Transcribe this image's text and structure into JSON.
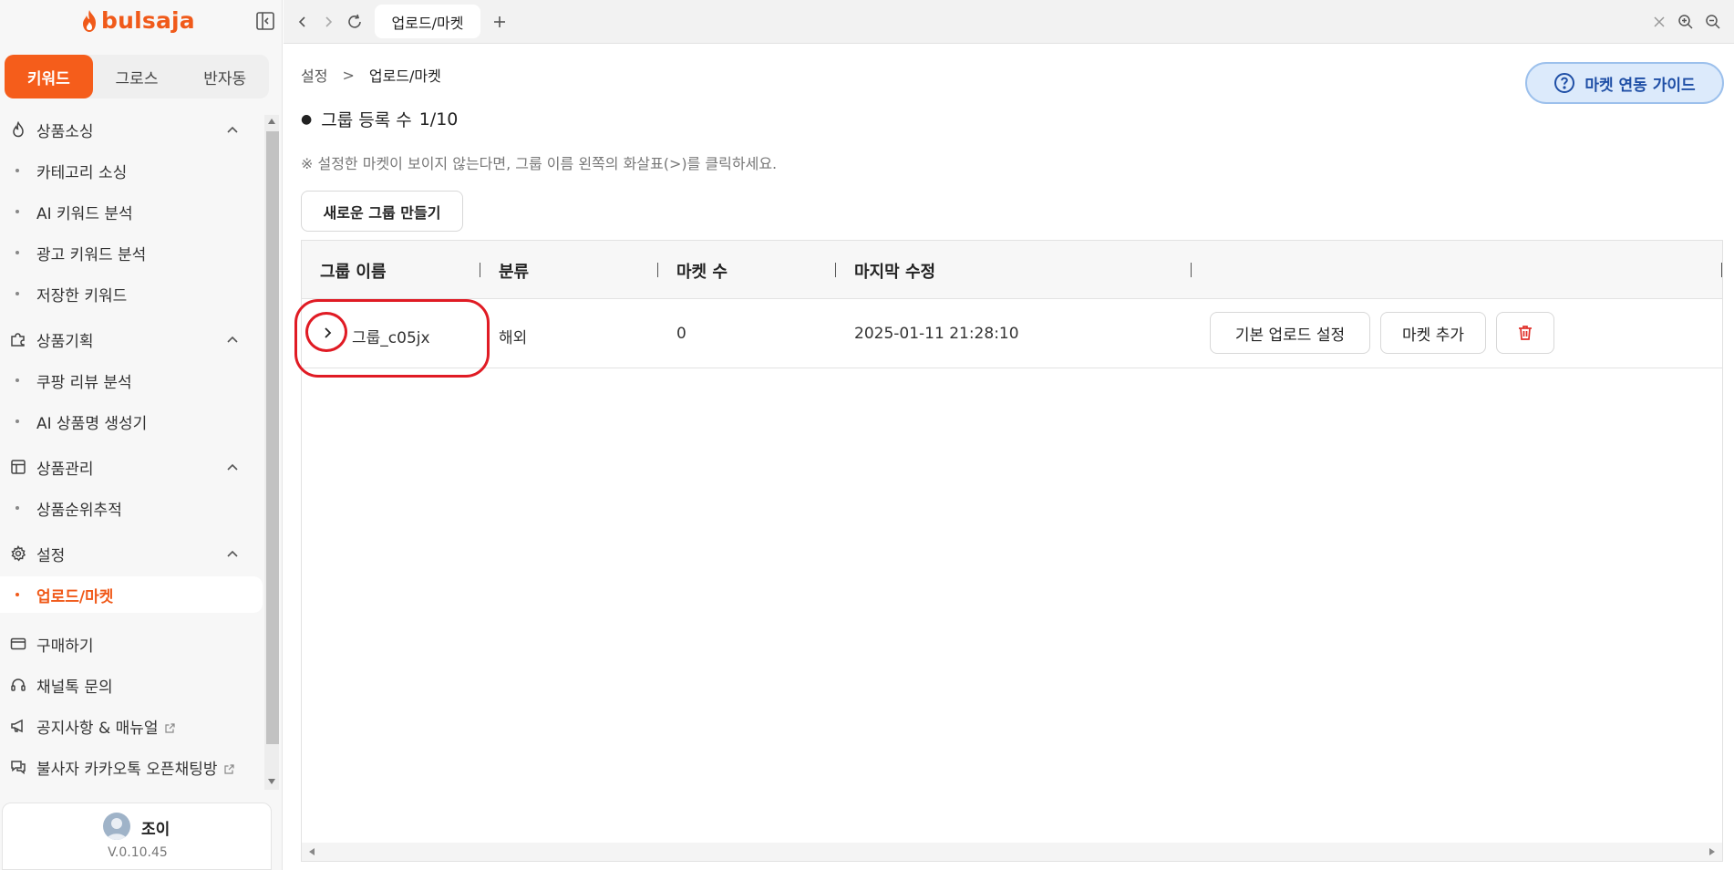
{
  "app": {
    "logo_text": "bulsaja"
  },
  "colors": {
    "accent": "#f55d1b",
    "guide_bg": "#dceafb",
    "guide_text": "#1f4fa6",
    "highlight": "#e01b24"
  },
  "sidebar": {
    "tabs": [
      {
        "label": "키워드",
        "active": true
      },
      {
        "label": "그로스",
        "active": false
      },
      {
        "label": "반자동",
        "active": false
      }
    ],
    "sections": [
      {
        "label": "상품소싱",
        "icon": "flame-icon",
        "items": [
          "카테고리 소싱",
          "AI 키워드 분석",
          "광고 키워드 분석",
          "저장한 키워드"
        ]
      },
      {
        "label": "상품기획",
        "icon": "puzzle-icon",
        "items": [
          "쿠팡 리뷰 분석",
          "AI 상품명 생성기"
        ]
      },
      {
        "label": "상품관리",
        "icon": "layout-icon",
        "items": [
          "상품순위추적"
        ]
      },
      {
        "label": "설정",
        "icon": "gear-icon",
        "items": [
          "업로드/마켓"
        ]
      }
    ],
    "active_item": "업로드/마켓",
    "bottom_links": [
      {
        "label": "구매하기",
        "icon": "card-icon"
      },
      {
        "label": "채널톡 문의",
        "icon": "headset-icon"
      },
      {
        "label": "공지사항 & 매뉴얼",
        "icon": "megaphone-icon",
        "external": true
      },
      {
        "label": "불사자 카카오톡 오픈채팅방",
        "icon": "chat-icon",
        "external": true
      }
    ],
    "user": {
      "name": "조이",
      "version": "V.0.10.45"
    }
  },
  "topbar": {
    "tab_label": "업로드/마켓"
  },
  "main": {
    "breadcrumb": {
      "parent": "설정",
      "sep": ">",
      "current": "업로드/마켓"
    },
    "guide_button": "마켓 연동 가이드",
    "group_count_label": "그룹 등록 수",
    "group_count_value": "1/10",
    "notice": "※ 설정한 마켓이 보이지 않는다면, 그룹 이름 왼쪽의 화살표(>)를 클릭하세요.",
    "new_group_button": "새로운 그룹 만들기",
    "table": {
      "columns": [
        "그룹 이름",
        "분류",
        "마켓 수",
        "마지막 수정"
      ],
      "rows": [
        {
          "name": "그룹_c05jx",
          "category": "해외",
          "market_count": "0",
          "modified": "2025-01-11 21:28:10",
          "actions": [
            "기본 업로드 설정",
            "마켓 추가"
          ]
        }
      ]
    }
  }
}
